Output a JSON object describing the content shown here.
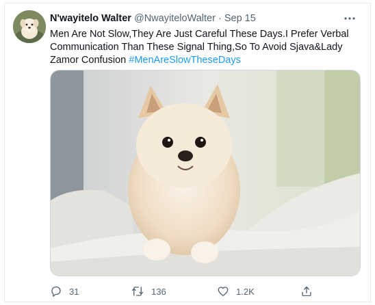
{
  "tweet": {
    "display_name": "N'wayitelo Walter",
    "handle": "@NwayiteloWalter",
    "separator": "·",
    "date": "Sep 15",
    "text": "Men Are Not Slow,They Are Just Careful These Days.I Prefer Verbal Communication Than These Signal Thing,So To Avoid Sjava&Lady Zamor Confusion ",
    "hashtag": "#MenAreSlowTheseDays"
  },
  "actions": {
    "replies": "31",
    "retweets": "136",
    "likes": "1.2K"
  },
  "icons": {
    "more": "more-icon",
    "reply": "reply-icon",
    "retweet": "retweet-icon",
    "like": "heart-icon",
    "share": "share-icon"
  },
  "colors": {
    "link": "#1d9bf0",
    "secondary_text": "#536471",
    "primary_text": "#0f1419"
  }
}
